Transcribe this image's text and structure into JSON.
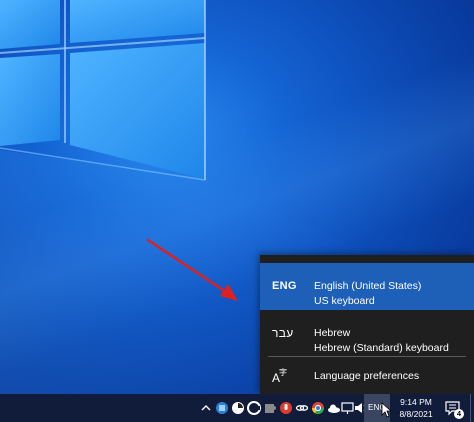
{
  "flyout": {
    "items": [
      {
        "code": "ENG",
        "language": "English (United States)",
        "keyboard": "US keyboard",
        "selected": true
      },
      {
        "code": "עבר",
        "language": "Hebrew",
        "keyboard": "Hebrew (Standard) keyboard",
        "selected": false
      }
    ],
    "preferences": {
      "icon": "language-icon",
      "label": "Language preferences"
    }
  },
  "taskbar": {
    "tray_icons": [
      "chevron-up-icon",
      "network-app-icon",
      "sync-icon",
      "c-icon",
      "puzzle-icon",
      "microphone-icon",
      "link-icon",
      "chrome-icon",
      "color-icon",
      "cloud-icon",
      "display-icon",
      "volume-icon"
    ],
    "input_indicator": "ENG",
    "time": "9:14 PM",
    "date": "8/8/2021",
    "notification_count": "4"
  },
  "colors": {
    "accent": "#1e5fb8",
    "flyout_bg": "#1f1f1f",
    "taskbar_bg": "#101c3a",
    "arrow": "#e02020"
  }
}
